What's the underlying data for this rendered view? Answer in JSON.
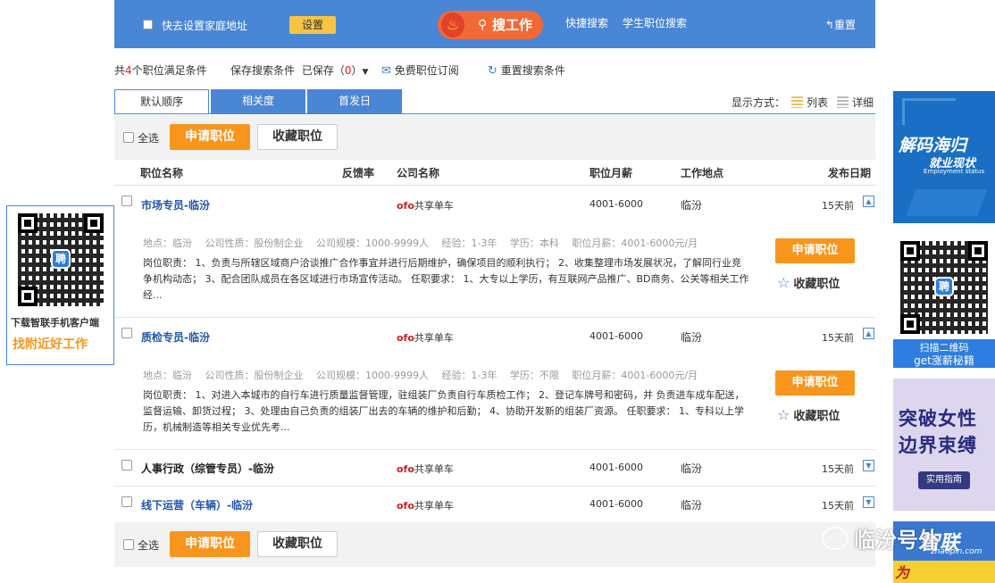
{
  "topbar": {
    "home_address_label": "快去设置家庭地址",
    "set_button": "设置",
    "search_button": "搜工作",
    "quick_search": "快捷搜索",
    "student_search": "学生职位搜索",
    "reset": "重置"
  },
  "info": {
    "total_prefix": "共",
    "total_count": "4",
    "total_suffix": "个职位满足条件",
    "save_label": "保存搜索条件",
    "saved_prefix": "已保存（",
    "saved_count": "0",
    "saved_suffix": "）",
    "subscribe": "免费职位订阅",
    "reset_conditions": "重置搜索条件"
  },
  "tabs": [
    "默认顺序",
    "相关度",
    "首发日"
  ],
  "view": {
    "label": "显示方式：",
    "list": "列表",
    "detail": "详细"
  },
  "toolbar": {
    "select_all": "全选",
    "apply": "申请职位",
    "favorite": "收藏职位"
  },
  "columns": [
    "职位名称",
    "反馈率",
    "公司名称",
    "职位月薪",
    "工作地点",
    "发布日期"
  ],
  "jobs": [
    {
      "title": "市场专员-临汾",
      "company_brand": "ofo",
      "company_rest": "共享单车",
      "salary": "4001-6000",
      "location": "临汾",
      "date": "15天前",
      "meta": "地点：临汾　 公司性质：股份制企业　 公司规模：1000-9999人　 经验：1-3年　 学历：本科　 职位月薪：4001-6000元/月",
      "desc": "岗位职责： 1、负责与所辖区域商户洽谈推广合作事宜并进行后期维护，确保项目的顺利执行； 2、收集整理市场发展状况，了解同行业竞争机构动态； 3、配合团队成员在各区域进行市场宣传活动。 任职要求： 1、大专以上学历，有互联网产品推广、BD商务、公关等相关工作经...",
      "apply": "申请职位",
      "favorite": "收藏职位"
    },
    {
      "title": "质检专员-临汾",
      "company_brand": "ofo",
      "company_rest": "共享单车",
      "salary": "4001-6000",
      "location": "临汾",
      "date": "15天前",
      "meta": "地点：临汾　 公司性质：股份制企业　 公司规模：1000-9999人　 经验：1-3年　 学历：不限　 职位月薪：4001-6000元/月",
      "desc": "岗位职责： 1、对进入本城市的自行车进行质量监督管理，驻组装厂负责自行车质检工作； 2、登记车牌号和密码，并 负责进车成车配送，监督运输、卸货过程； 3、处理由自己负责的组装厂出去的车辆的维护和后勤； 4、协助开发新的组装厂资源。 任职要求： 1、专科以上学历，机械制造等相关专业优先考...",
      "apply": "申请职位",
      "favorite": "收藏职位"
    },
    {
      "title": "人事行政（综管专员）-临汾",
      "company_brand": "ofo",
      "company_rest": "共享单车",
      "salary": "4001-6000",
      "location": "临汾",
      "date": "15天前"
    },
    {
      "title": "线下运营（车辆）-临汾",
      "company_brand": "ofo",
      "company_rest": "共享单车",
      "salary": "4001-6000",
      "location": "临汾",
      "date": "15天前"
    }
  ],
  "left_qr": {
    "line1": "下载智联手机客户端",
    "line2": "找附近好工作",
    "logo": "聘"
  },
  "ads": {
    "ad1_title": "解码海归",
    "ad1_sub": "就业现状",
    "ad1_en": "Employment status",
    "ad2_line1": "扫描二维码",
    "ad2_line2": "get涨薪秘籍",
    "ad3_line1": "突破女性",
    "ad3_line2": "边界束缚",
    "ad3_button": "实用指南",
    "ad4_title": "智联",
    "ad4_url": "zhaopin.com",
    "ad4_bottom": "为"
  },
  "watermark": "临汾号外",
  "colors": {
    "brand_blue": "#4a86d6",
    "apply_orange": "#f7951d",
    "search_orange": "#f16a36"
  }
}
